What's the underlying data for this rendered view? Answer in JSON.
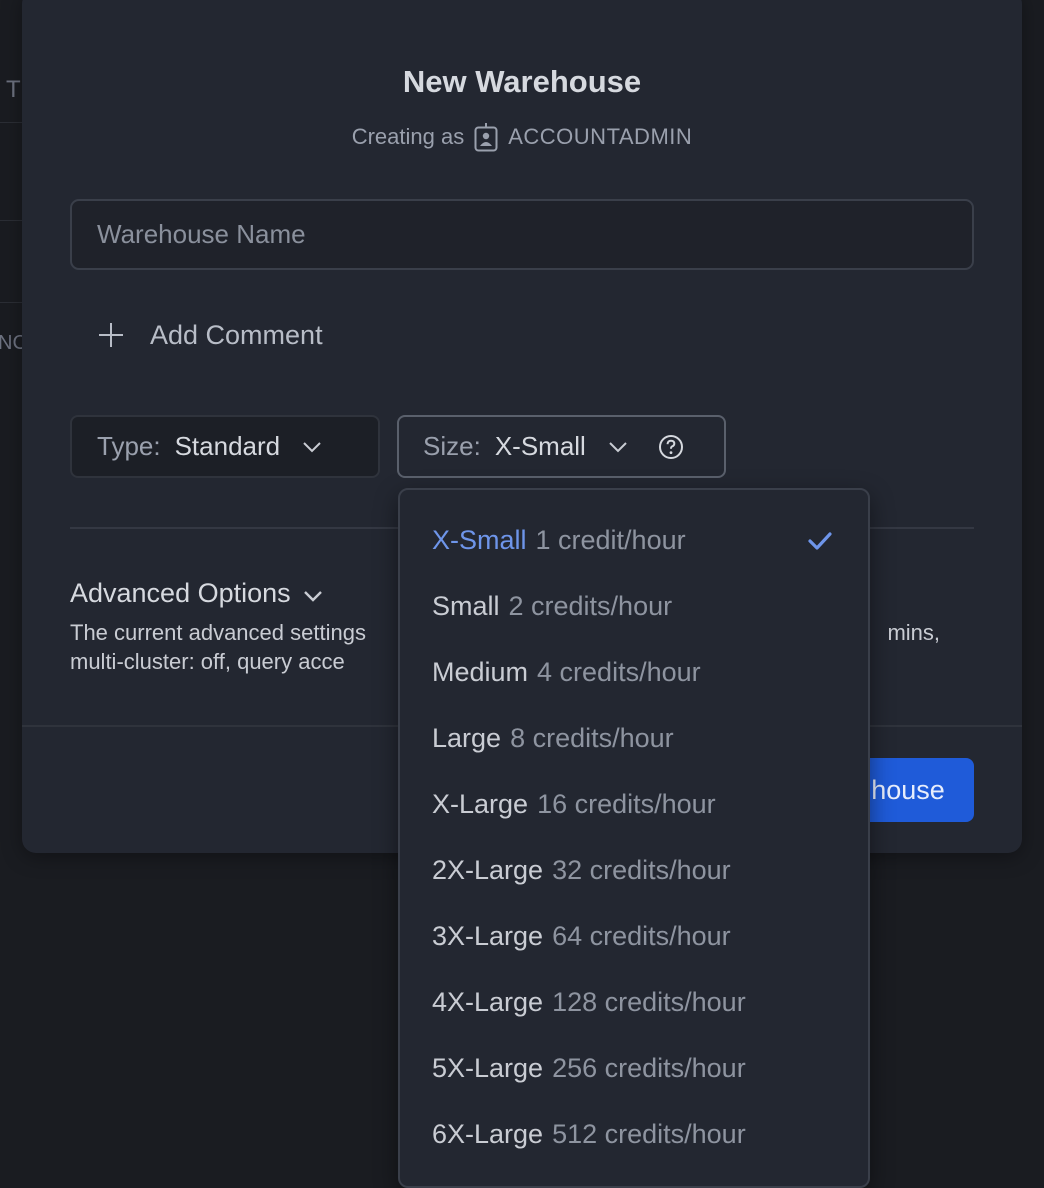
{
  "background": {
    "fragment_1": "T",
    "fragment_2": "NC"
  },
  "modal": {
    "title": "New Warehouse",
    "subtitle_prefix": "Creating as",
    "role": "ACCOUNTADMIN",
    "name_placeholder": "Warehouse Name",
    "add_comment": "Add Comment",
    "type_label": "Type:",
    "type_value": "Standard",
    "size_label": "Size:",
    "size_value": "X-Small",
    "advanced_title": "Advanced Options",
    "advanced_desc_line1": "The current advanced settings",
    "advanced_desc_line1_end": "mins,",
    "advanced_desc_line2": "multi-cluster: off, query acce",
    "create_button_visible": "house"
  },
  "dropdown": {
    "options": [
      {
        "name": "X-Small",
        "credits": "1 credit/hour",
        "selected": true
      },
      {
        "name": "Small",
        "credits": "2 credits/hour",
        "selected": false
      },
      {
        "name": "Medium",
        "credits": "4 credits/hour",
        "selected": false
      },
      {
        "name": "Large",
        "credits": "8 credits/hour",
        "selected": false
      },
      {
        "name": "X-Large",
        "credits": "16 credits/hour",
        "selected": false
      },
      {
        "name": "2X-Large",
        "credits": "32 credits/hour",
        "selected": false
      },
      {
        "name": "3X-Large",
        "credits": "64 credits/hour",
        "selected": false
      },
      {
        "name": "4X-Large",
        "credits": "128 credits/hour",
        "selected": false
      },
      {
        "name": "5X-Large",
        "credits": "256 credits/hour",
        "selected": false
      },
      {
        "name": "6X-Large",
        "credits": "512 credits/hour",
        "selected": false
      }
    ]
  },
  "icons": {
    "badge": "id-badge-icon",
    "plus": "plus-icon",
    "chevron": "chevron-down-icon",
    "help": "help-circle-icon",
    "check": "check-icon"
  },
  "colors": {
    "accent": "#6e95ea",
    "primary_button": "#1f5bd9",
    "modal_bg": "#232731",
    "page_bg": "#1a1c21"
  }
}
